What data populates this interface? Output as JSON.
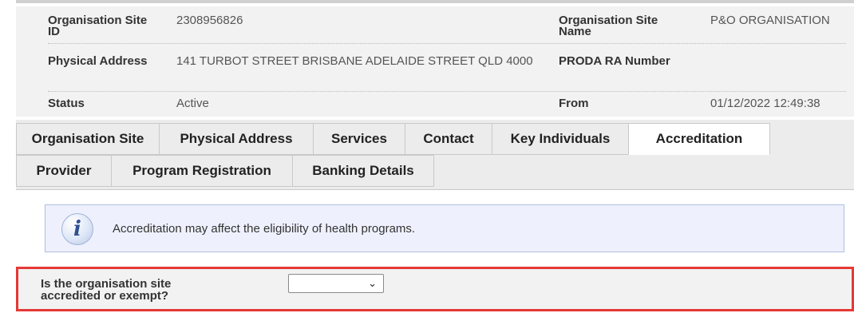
{
  "details": {
    "rows": [
      {
        "label1": "Organisation Site ID",
        "value1": "2308956826",
        "label2": "Organisation Site Name",
        "value2": "P&O ORGANISATION"
      },
      {
        "label1": "Physical Address",
        "value1": "141 TURBOT STREET BRISBANE ADELAIDE STREET QLD 4000",
        "label2": "PRODA RA Number",
        "value2": ""
      },
      {
        "label1": "Status",
        "value1": "Active",
        "label2": "From",
        "value2": "01/12/2022 12:49:38"
      }
    ]
  },
  "tabs": {
    "row1": [
      "Organisation Site",
      "Physical Address",
      "Services",
      "Contact",
      "Key Individuals",
      "Accreditation"
    ],
    "row2": [
      "Provider",
      "Program Registration",
      "Banking Details"
    ],
    "active": "Accreditation"
  },
  "info": {
    "icon": "info-icon",
    "glyph": "i",
    "message": "Accreditation may affect the eligibility of health programs."
  },
  "question": {
    "label": "Is the organisation site accredited or exempt?",
    "selected_value": "",
    "chevron": "⌄"
  },
  "colors": {
    "highlight_border": "#e53935",
    "info_background": "#eef1fd"
  }
}
